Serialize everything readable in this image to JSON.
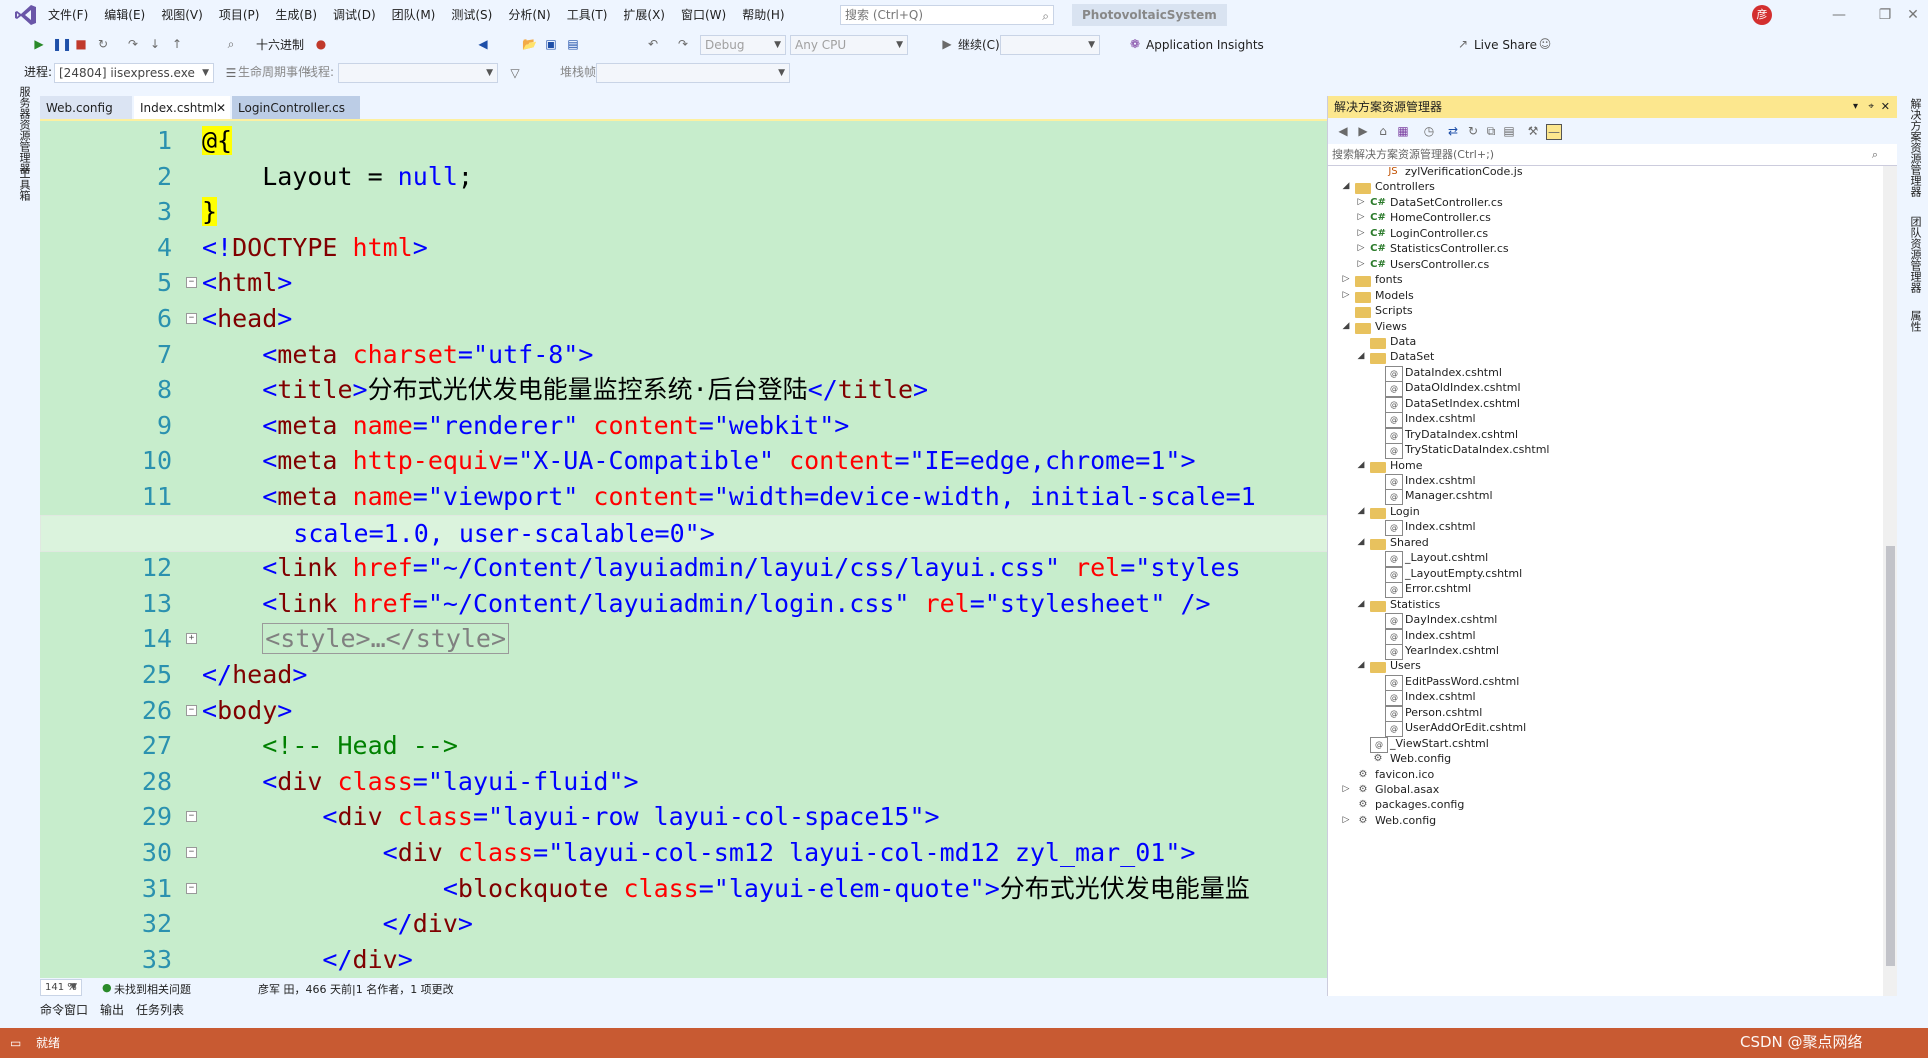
{
  "menubar": {
    "items": [
      "文件(F)",
      "编辑(E)",
      "视图(V)",
      "项目(P)",
      "生成(B)",
      "调试(D)",
      "团队(M)",
      "测试(S)",
      "分析(N)",
      "工具(T)",
      "扩展(X)",
      "窗口(W)",
      "帮助(H)"
    ],
    "search_placeholder": "搜索 (Ctrl+Q)",
    "solution_name": "PhotovoltaicSystem",
    "avatar_initial": "彦"
  },
  "toolbar1": {
    "hex_label": "十六进制",
    "config": "Debug",
    "platform": "Any CPU",
    "continue_label": "继续(C)",
    "app_insights": "Application Insights",
    "live_share": "Live Share"
  },
  "toolbar2": {
    "process_label": "进程:",
    "process_value": "[24804] iisexpress.exe",
    "lifecycle_label": "生命周期事件",
    "thread_label": "线程:",
    "stackframe_label": "堆栈帧:"
  },
  "left_strip": {
    "item1": "服务器资源管理器",
    "item2": "工具箱"
  },
  "tabs": [
    {
      "label": "Web.config"
    },
    {
      "label": "Index.cshtml"
    },
    {
      "label": "LoginController.cs"
    }
  ],
  "code": {
    "lines": [
      {
        "num": "1",
        "segs": [
          [
            "t-razor",
            "@{"
          ]
        ]
      },
      {
        "num": "2",
        "segs": [
          [
            "t-text",
            "    Layout = "
          ],
          [
            "t-kw",
            "null"
          ],
          [
            "t-text",
            ";"
          ]
        ]
      },
      {
        "num": "3",
        "segs": [
          [
            "t-razor",
            "}"
          ]
        ]
      },
      {
        "num": "4",
        "segs": [
          [
            "t-bracket",
            "<!"
          ],
          [
            "t-tag",
            "DOCTYPE"
          ],
          [
            "t-text",
            " "
          ],
          [
            "t-attr",
            "html"
          ],
          [
            "t-bracket",
            ">"
          ]
        ]
      },
      {
        "num": "5",
        "segs": [
          [
            "t-bracket",
            "<"
          ],
          [
            "t-tag",
            "html"
          ],
          [
            "t-bracket",
            ">"
          ]
        ]
      },
      {
        "num": "6",
        "segs": [
          [
            "t-bracket",
            "<"
          ],
          [
            "t-tag",
            "head"
          ],
          [
            "t-bracket",
            ">"
          ]
        ]
      },
      {
        "num": "7",
        "segs": [
          [
            "t-text",
            "    "
          ],
          [
            "t-bracket",
            "<"
          ],
          [
            "t-tag",
            "meta"
          ],
          [
            "t-text",
            " "
          ],
          [
            "t-attr",
            "charset"
          ],
          [
            "t-bracket",
            "="
          ],
          [
            "t-val",
            "\"utf-8\""
          ],
          [
            "t-bracket",
            ">"
          ]
        ]
      },
      {
        "num": "8",
        "segs": [
          [
            "t-text",
            "    "
          ],
          [
            "t-bracket",
            "<"
          ],
          [
            "t-tag",
            "title"
          ],
          [
            "t-bracket",
            ">"
          ],
          [
            "t-text",
            "分布式光伏发电能量监控系统·后台登陆"
          ],
          [
            "t-bracket",
            "</"
          ],
          [
            "t-tag",
            "title"
          ],
          [
            "t-bracket",
            ">"
          ]
        ]
      },
      {
        "num": "9",
        "segs": [
          [
            "t-text",
            "    "
          ],
          [
            "t-bracket",
            "<"
          ],
          [
            "t-tag",
            "meta"
          ],
          [
            "t-text",
            " "
          ],
          [
            "t-attr",
            "name"
          ],
          [
            "t-bracket",
            "="
          ],
          [
            "t-val",
            "\"renderer\""
          ],
          [
            "t-text",
            " "
          ],
          [
            "t-attr",
            "content"
          ],
          [
            "t-bracket",
            "="
          ],
          [
            "t-val",
            "\"webkit\""
          ],
          [
            "t-bracket",
            ">"
          ]
        ]
      },
      {
        "num": "10",
        "segs": [
          [
            "t-text",
            "    "
          ],
          [
            "t-bracket",
            "<"
          ],
          [
            "t-tag",
            "meta"
          ],
          [
            "t-text",
            " "
          ],
          [
            "t-attr",
            "http-equiv"
          ],
          [
            "t-bracket",
            "="
          ],
          [
            "t-val",
            "\"X-UA-Compatible\""
          ],
          [
            "t-text",
            " "
          ],
          [
            "t-attr",
            "content"
          ],
          [
            "t-bracket",
            "="
          ],
          [
            "t-val",
            "\"IE=edge,chrome=1\""
          ],
          [
            "t-bracket",
            ">"
          ]
        ]
      },
      {
        "num": "11",
        "segs": [
          [
            "t-text",
            "    "
          ],
          [
            "t-bracket",
            "<"
          ],
          [
            "t-tag",
            "meta"
          ],
          [
            "t-text",
            " "
          ],
          [
            "t-attr",
            "name"
          ],
          [
            "t-bracket",
            "="
          ],
          [
            "t-val",
            "\"viewport\""
          ],
          [
            "t-text",
            " "
          ],
          [
            "t-attr",
            "content"
          ],
          [
            "t-bracket",
            "="
          ],
          [
            "t-val",
            "\"width=device-width, initial-scale=1"
          ]
        ]
      },
      {
        "num": "",
        "segs": [
          [
            "t-val",
            "      scale=1.0, user-scalable=0\""
          ],
          [
            "t-bracket",
            ">"
          ]
        ]
      },
      {
        "num": "12",
        "segs": [
          [
            "t-text",
            "    "
          ],
          [
            "t-bracket",
            "<"
          ],
          [
            "t-tag",
            "link"
          ],
          [
            "t-text",
            " "
          ],
          [
            "t-attr",
            "href"
          ],
          [
            "t-bracket",
            "="
          ],
          [
            "t-val",
            "\"~/Content/layuiadmin/layui/css/layui.css\""
          ],
          [
            "t-text",
            " "
          ],
          [
            "t-attr",
            "rel"
          ],
          [
            "t-bracket",
            "="
          ],
          [
            "t-val",
            "\"styles"
          ]
        ]
      },
      {
        "num": "13",
        "segs": [
          [
            "t-text",
            "    "
          ],
          [
            "t-bracket",
            "<"
          ],
          [
            "t-tag",
            "link"
          ],
          [
            "t-text",
            " "
          ],
          [
            "t-attr",
            "href"
          ],
          [
            "t-bracket",
            "="
          ],
          [
            "t-val",
            "\"~/Content/layuiadmin/login.css\""
          ],
          [
            "t-text",
            " "
          ],
          [
            "t-attr",
            "rel"
          ],
          [
            "t-bracket",
            "="
          ],
          [
            "t-val",
            "\"stylesheet\""
          ],
          [
            "t-text",
            " "
          ],
          [
            "t-bracket",
            "/>"
          ]
        ]
      },
      {
        "num": "14",
        "segs": [
          [
            "t-text",
            "    "
          ],
          [
            "t-collapsed",
            "<style>…</style>"
          ]
        ]
      },
      {
        "num": "25",
        "segs": [
          [
            "t-bracket",
            "</"
          ],
          [
            "t-tag",
            "head"
          ],
          [
            "t-bracket",
            ">"
          ]
        ]
      },
      {
        "num": "26",
        "segs": [
          [
            "t-bracket",
            "<"
          ],
          [
            "t-tag",
            "body"
          ],
          [
            "t-bracket",
            ">"
          ]
        ]
      },
      {
        "num": "27",
        "segs": [
          [
            "t-text",
            "    "
          ],
          [
            "t-cm",
            "<!-- Head -->"
          ]
        ]
      },
      {
        "num": "28",
        "segs": [
          [
            "t-text",
            "    "
          ],
          [
            "t-bracket",
            "<"
          ],
          [
            "t-tag",
            "div"
          ],
          [
            "t-text",
            " "
          ],
          [
            "t-attr",
            "class"
          ],
          [
            "t-bracket",
            "="
          ],
          [
            "t-val",
            "\"layui-fluid\""
          ],
          [
            "t-bracket",
            ">"
          ]
        ]
      },
      {
        "num": "29",
        "segs": [
          [
            "t-text",
            "        "
          ],
          [
            "t-bracket",
            "<"
          ],
          [
            "t-tag",
            "div"
          ],
          [
            "t-text",
            " "
          ],
          [
            "t-attr",
            "class"
          ],
          [
            "t-bracket",
            "="
          ],
          [
            "t-val",
            "\"layui-row layui-col-space15\""
          ],
          [
            "t-bracket",
            ">"
          ]
        ]
      },
      {
        "num": "30",
        "segs": [
          [
            "t-text",
            "            "
          ],
          [
            "t-bracket",
            "<"
          ],
          [
            "t-tag",
            "div"
          ],
          [
            "t-text",
            " "
          ],
          [
            "t-attr",
            "class"
          ],
          [
            "t-bracket",
            "="
          ],
          [
            "t-val",
            "\"layui-col-sm12 layui-col-md12 zyl_mar_01\""
          ],
          [
            "t-bracket",
            ">"
          ]
        ]
      },
      {
        "num": "31",
        "segs": [
          [
            "t-text",
            "                "
          ],
          [
            "t-bracket",
            "<"
          ],
          [
            "t-tag",
            "blockquote"
          ],
          [
            "t-text",
            " "
          ],
          [
            "t-attr",
            "class"
          ],
          [
            "t-bracket",
            "="
          ],
          [
            "t-val",
            "\"layui-elem-quote\""
          ],
          [
            "t-bracket",
            ">"
          ],
          [
            "t-text",
            "分布式光伏发电能量监"
          ]
        ]
      },
      {
        "num": "32",
        "segs": [
          [
            "t-text",
            "            "
          ],
          [
            "t-bracket",
            "</"
          ],
          [
            "t-tag",
            "div"
          ],
          [
            "t-bracket",
            ">"
          ]
        ]
      },
      {
        "num": "33",
        "segs": [
          [
            "t-text",
            "        "
          ],
          [
            "t-bracket",
            "</"
          ],
          [
            "t-tag",
            "div"
          ],
          [
            "t-bracket",
            ">"
          ]
        ]
      }
    ]
  },
  "editor_status": {
    "zoom": "141 %",
    "issues": "未找到相关问题",
    "codelens": "彦军 田，466 天前|1 名作者，1 项更改"
  },
  "solution_explorer": {
    "title": "解决方案资源管理器",
    "search_placeholder": "搜索解决方案资源管理器(Ctrl+;)",
    "tree": [
      {
        "label": "zylVerificationCode.js",
        "level": 4,
        "icon": "js",
        "arrow": ""
      },
      {
        "label": "Controllers",
        "level": 2,
        "icon": "folder",
        "arrow": "open"
      },
      {
        "label": "DataSetController.cs",
        "level": 3,
        "icon": "cs",
        "arrow": "closed"
      },
      {
        "label": "HomeController.cs",
        "level": 3,
        "icon": "cs",
        "arrow": "closed"
      },
      {
        "label": "LoginController.cs",
        "level": 3,
        "icon": "cs",
        "arrow": "closed"
      },
      {
        "label": "StatisticsController.cs",
        "level": 3,
        "icon": "cs",
        "arrow": "closed"
      },
      {
        "label": "UsersController.cs",
        "level": 3,
        "icon": "cs",
        "arrow": "closed"
      },
      {
        "label": "fonts",
        "level": 2,
        "icon": "folder",
        "arrow": "closed"
      },
      {
        "label": "Models",
        "level": 2,
        "icon": "folder",
        "arrow": "closed"
      },
      {
        "label": "Scripts",
        "level": 2,
        "icon": "folder",
        "arrow": ""
      },
      {
        "label": "Views",
        "level": 2,
        "icon": "folder",
        "arrow": "open"
      },
      {
        "label": "Data",
        "level": 3,
        "icon": "folder",
        "arrow": ""
      },
      {
        "label": "DataSet",
        "level": 3,
        "icon": "folder",
        "arrow": "open"
      },
      {
        "label": "DataIndex.cshtml",
        "level": 4,
        "icon": "cshtml",
        "arrow": ""
      },
      {
        "label": "DataOldIndex.cshtml",
        "level": 4,
        "icon": "cshtml",
        "arrow": ""
      },
      {
        "label": "DataSetIndex.cshtml",
        "level": 4,
        "icon": "cshtml",
        "arrow": ""
      },
      {
        "label": "Index.cshtml",
        "level": 4,
        "icon": "cshtml",
        "arrow": ""
      },
      {
        "label": "TryDataIndex.cshtml",
        "level": 4,
        "icon": "cshtml",
        "arrow": ""
      },
      {
        "label": "TryStaticDataIndex.cshtml",
        "level": 4,
        "icon": "cshtml",
        "arrow": ""
      },
      {
        "label": "Home",
        "level": 3,
        "icon": "folder",
        "arrow": "open"
      },
      {
        "label": "Index.cshtml",
        "level": 4,
        "icon": "cshtml",
        "arrow": ""
      },
      {
        "label": "Manager.cshtml",
        "level": 4,
        "icon": "cshtml",
        "arrow": ""
      },
      {
        "label": "Login",
        "level": 3,
        "icon": "folder",
        "arrow": "open"
      },
      {
        "label": "Index.cshtml",
        "level": 4,
        "icon": "cshtml",
        "arrow": ""
      },
      {
        "label": "Shared",
        "level": 3,
        "icon": "folder",
        "arrow": "open"
      },
      {
        "label": "_Layout.cshtml",
        "level": 4,
        "icon": "cshtml",
        "arrow": ""
      },
      {
        "label": "_LayoutEmpty.cshtml",
        "level": 4,
        "icon": "cshtml",
        "arrow": ""
      },
      {
        "label": "Error.cshtml",
        "level": 4,
        "icon": "cshtml",
        "arrow": ""
      },
      {
        "label": "Statistics",
        "level": 3,
        "icon": "folder",
        "arrow": "open"
      },
      {
        "label": "DayIndex.cshtml",
        "level": 4,
        "icon": "cshtml",
        "arrow": ""
      },
      {
        "label": "Index.cshtml",
        "level": 4,
        "icon": "cshtml",
        "arrow": ""
      },
      {
        "label": "YearIndex.cshtml",
        "level": 4,
        "icon": "cshtml",
        "arrow": ""
      },
      {
        "label": "Users",
        "level": 3,
        "icon": "folder",
        "arrow": "open"
      },
      {
        "label": "EditPassWord.cshtml",
        "level": 4,
        "icon": "cshtml",
        "arrow": ""
      },
      {
        "label": "Index.cshtml",
        "level": 4,
        "icon": "cshtml",
        "arrow": ""
      },
      {
        "label": "Person.cshtml",
        "level": 4,
        "icon": "cshtml",
        "arrow": ""
      },
      {
        "label": "UserAddOrEdit.cshtml",
        "level": 4,
        "icon": "cshtml",
        "arrow": ""
      },
      {
        "label": "_ViewStart.cshtml",
        "level": 3,
        "icon": "cshtml",
        "arrow": ""
      },
      {
        "label": "Web.config",
        "level": 3,
        "icon": "config",
        "arrow": ""
      },
      {
        "label": "favicon.ico",
        "level": 2,
        "icon": "config",
        "arrow": ""
      },
      {
        "label": "Global.asax",
        "level": 2,
        "icon": "config",
        "arrow": "closed"
      },
      {
        "label": "packages.config",
        "level": 2,
        "icon": "config",
        "arrow": ""
      },
      {
        "label": "Web.config",
        "level": 2,
        "icon": "config",
        "arrow": "closed"
      }
    ]
  },
  "right_strip": {
    "item1": "解决方案资源管理器",
    "item2": "团队资源管理器",
    "item3": "属性"
  },
  "bottom_tabs": [
    "命令窗口",
    "输出",
    "任务列表"
  ],
  "statusbar": {
    "text": "就绪",
    "watermark": "CSDN @聚点网络"
  },
  "colors": {
    "accent": "#c85a32",
    "editor_bg": "#c7edcc",
    "panel_header": "#fce78e"
  }
}
